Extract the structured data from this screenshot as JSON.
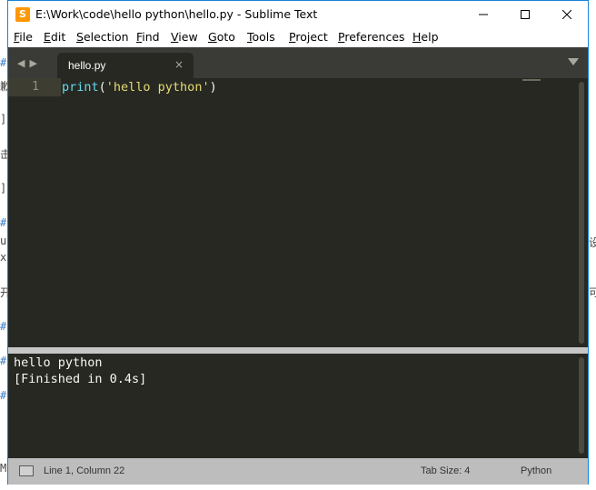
{
  "window": {
    "title": "E:\\Work\\code\\hello python\\hello.py - Sublime Text",
    "app_icon_letter": "S"
  },
  "menu": [
    "File",
    "Edit",
    "Selection",
    "Find",
    "View",
    "Goto",
    "Tools",
    "Project",
    "Preferences",
    "Help"
  ],
  "tabs": [
    {
      "label": "hello.py",
      "close": "×"
    }
  ],
  "editor": {
    "line_number": "1",
    "code": {
      "func": "print",
      "open": "(",
      "string": "'hello python'",
      "close": ")"
    }
  },
  "output": {
    "lines": [
      "hello python",
      "[Finished in 0.4s]"
    ]
  },
  "statusbar": {
    "position": "Line 1, Column 22",
    "tab_size": "Tab Size: 4",
    "syntax": "Python"
  },
  "colors": {
    "editor_bg": "#272822",
    "function": "#66d9ef",
    "string": "#e6db74",
    "foreground": "#f8f8f2"
  },
  "background_marks": [
    "#",
    "歉",
    "]",
    "击",
    "]",
    "#",
    "u",
    "x",
    "开",
    "#",
    "#",
    "#",
    "M",
    "设",
    "可"
  ],
  "icons": {
    "nav": "left-right-arrows",
    "dropdown": "triangle-down",
    "status": "console-panel-icon"
  }
}
